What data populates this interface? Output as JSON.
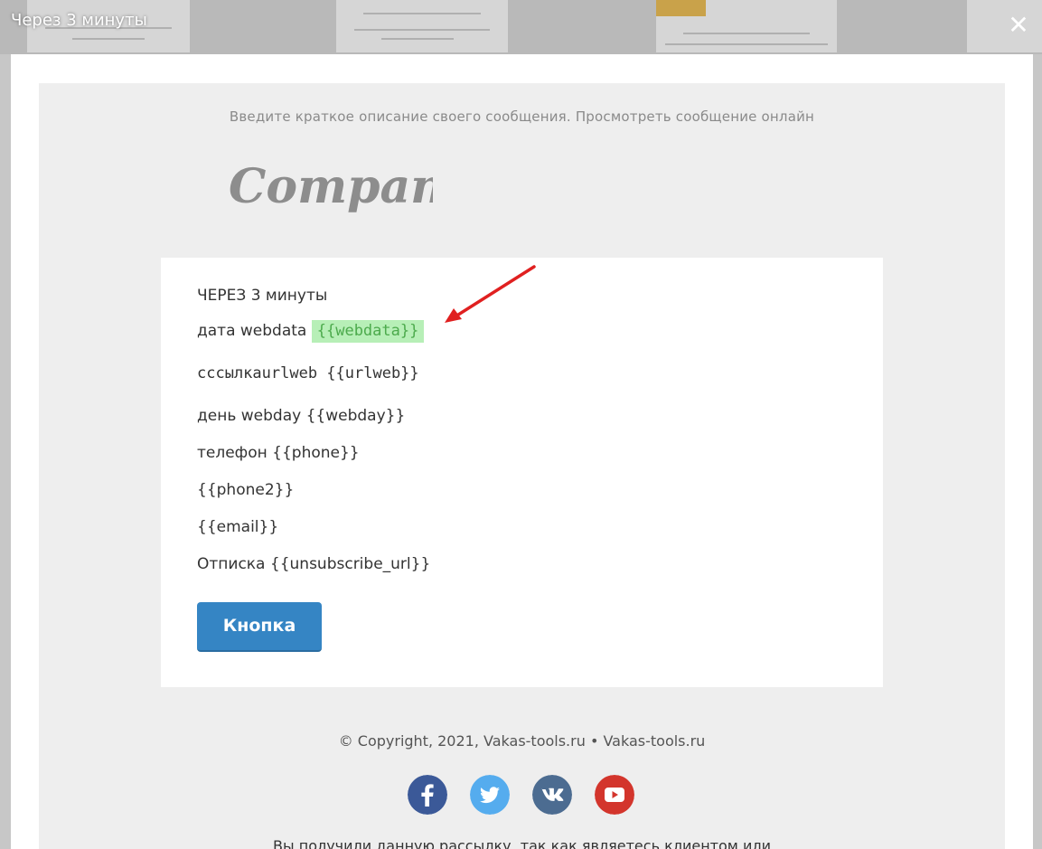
{
  "overlay": {
    "title": "Через 3 минуты",
    "close_glyph": "✕"
  },
  "email": {
    "preheader": "Введите краткое описание своего сообщения. Просмотреть сообщение онлайн",
    "logo_text": "Company",
    "lines": [
      {
        "label": "ЧЕРЕЗ 3 минуты",
        "tag": ""
      },
      {
        "label": "дата webdata ",
        "tag": "{{webdata}}"
      },
      {
        "label": "сссылкаurlweb ",
        "tag": "{{urlweb}}"
      },
      {
        "label": "день webday ",
        "tag": "{{webday}}"
      },
      {
        "label": "телефон ",
        "tag": "{{phone}}"
      },
      {
        "label": "",
        "tag": "{{phone2}}"
      },
      {
        "label": "",
        "tag": "{{email}}"
      },
      {
        "label": "Отписка ",
        "tag": "{{unsubscribe_url}}"
      }
    ],
    "button_label": "Кнопка",
    "copyright": "© Copyright, 2021, Vakas-tools.ru • Vakas-tools.ru",
    "footer_note": "Вы получили данную рассылку, так как являетесь клиентом или",
    "social": [
      {
        "icon": "facebook-icon",
        "glyph": "f",
        "color": "#3b5998"
      },
      {
        "icon": "twitter-icon",
        "glyph": "t",
        "color": "#55acee"
      },
      {
        "icon": "vk-icon",
        "glyph": "vk",
        "color": "#4c6c91"
      },
      {
        "icon": "youtube-icon",
        "glyph": "▶",
        "color": "#d3352c"
      }
    ]
  },
  "colors": {
    "highlight_bg": "#b7efb7",
    "highlight_text": "#4caa4c",
    "button": "#3585c4",
    "arrow": "#e02020"
  }
}
